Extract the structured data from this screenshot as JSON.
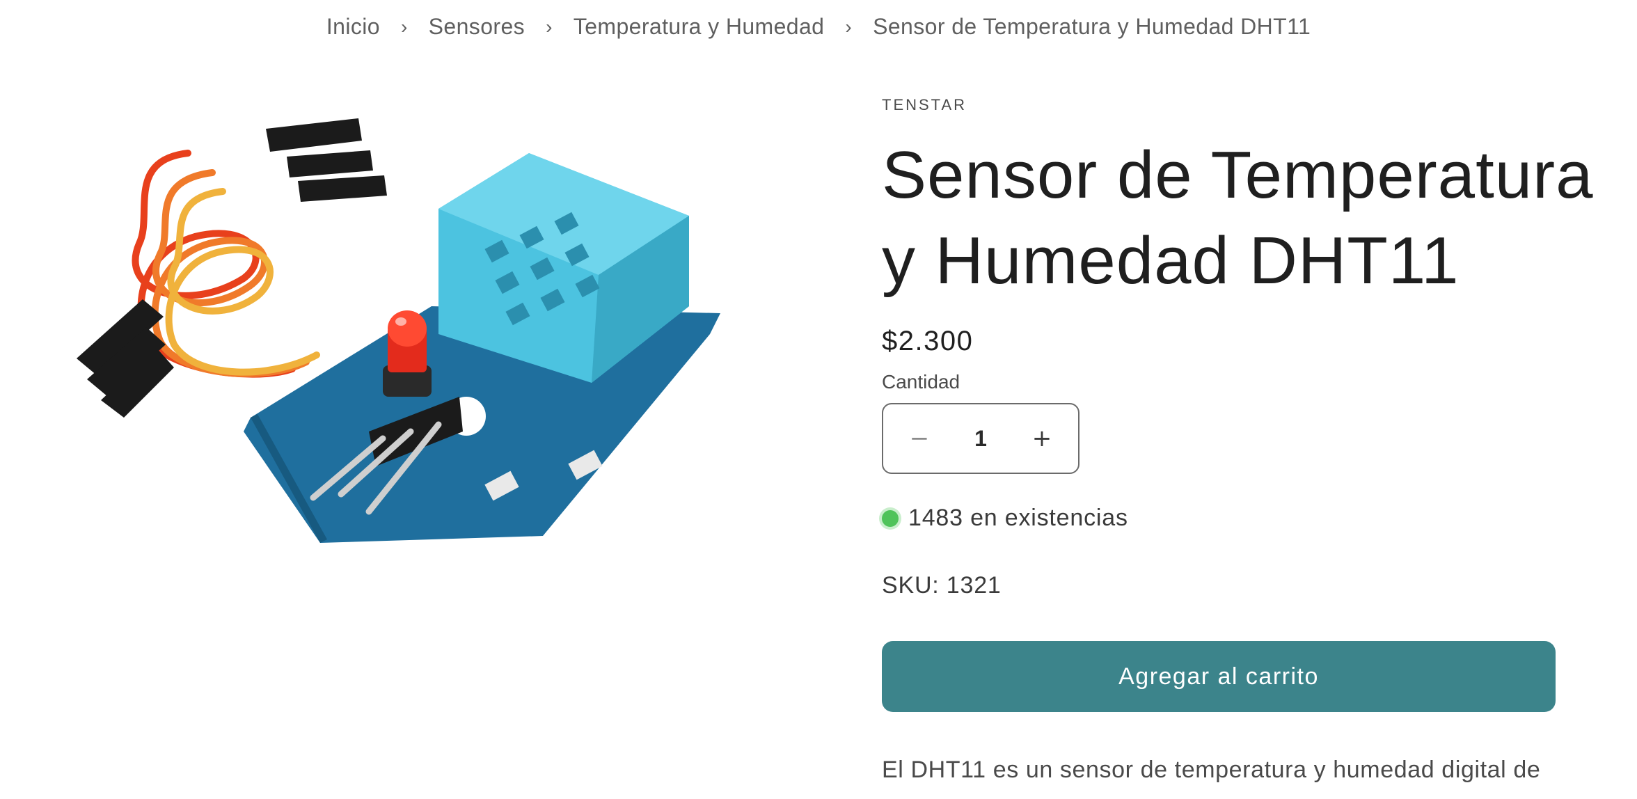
{
  "breadcrumb": {
    "items": [
      "Inicio",
      "Sensores",
      "Temperatura y Humedad",
      "Sensor de Temperatura y Humedad DHT11"
    ],
    "separator": "›"
  },
  "product": {
    "vendor": "TENSTAR",
    "title_line1": "Sensor de Temperatura",
    "title_line2": "y Humedad DHT11",
    "price": "$2.300",
    "quantity_label": "Cantidad",
    "quantity_value": "1",
    "quantity_decrease": "−",
    "quantity_increase": "+",
    "stock_text": "1483 en existencias",
    "sku_text": "SKU: 1321",
    "add_to_cart_label": "Agregar al carrito",
    "description_start": "El DHT11 es un sensor de temperatura y humedad digital de"
  },
  "colors": {
    "accent": "#3c848b",
    "stock_dot": "#4fc35a",
    "sensor_housing": "#4cc3e0",
    "pcb": "#1f6f9e"
  },
  "icons": {
    "stock": "in-stock-dot-icon",
    "decrease": "minus-icon",
    "increase": "plus-icon"
  }
}
